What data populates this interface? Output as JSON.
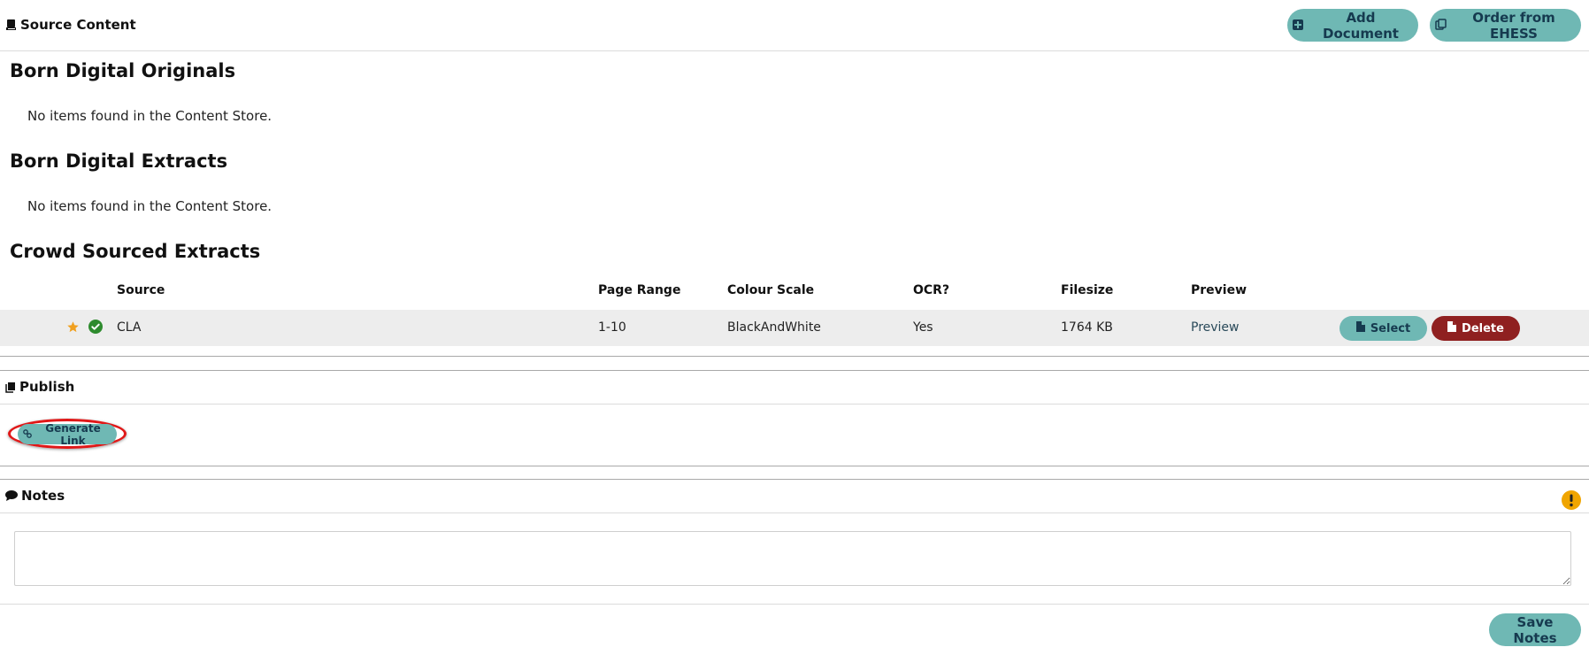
{
  "source_panel": {
    "title": "Source Content",
    "add_document_label": "Add Document",
    "order_label": "Order from EHESS"
  },
  "sections": {
    "born_digital_originals": {
      "title": "Born Digital Originals",
      "empty_text": "No items found in the Content Store."
    },
    "born_digital_extracts": {
      "title": "Born Digital Extracts",
      "empty_text": "No items found in the Content Store."
    },
    "crowd_sourced_extracts": {
      "title": "Crowd Sourced Extracts",
      "columns": [
        "Source",
        "Page Range",
        "Colour Scale",
        "OCR?",
        "Filesize",
        "Preview"
      ],
      "rows": [
        {
          "source": "CLA",
          "page_range": "1-10",
          "colour_scale": "BlackAndWhite",
          "ocr": "Yes",
          "filesize": "1764 KB",
          "preview": "Preview",
          "select_label": "Select",
          "delete_label": "Delete"
        }
      ]
    }
  },
  "publish_panel": {
    "title": "Publish",
    "generate_link_label": "Generate Link"
  },
  "notes_panel": {
    "title": "Notes",
    "notes_value": "",
    "save_label": "Save Notes"
  },
  "colors": {
    "accent_teal": "#6fb8b4",
    "button_text_navy": "#163a4f",
    "danger": "#8f2020",
    "star": "#f0a020",
    "check": "#2e8b2e",
    "warning": "#f0a500",
    "highlight_ring": "#e01818"
  },
  "icons": {
    "source_header": "book-icon",
    "add_document": "plus-square-icon",
    "order": "copy-icon",
    "featured": "star-icon",
    "status": "check-circle-icon",
    "select": "file-icon",
    "delete": "file-icon",
    "publish_header": "book-icon",
    "generate_link": "link-icon",
    "notes_header": "comment-icon",
    "notes_alert": "exclamation-circle-icon"
  }
}
